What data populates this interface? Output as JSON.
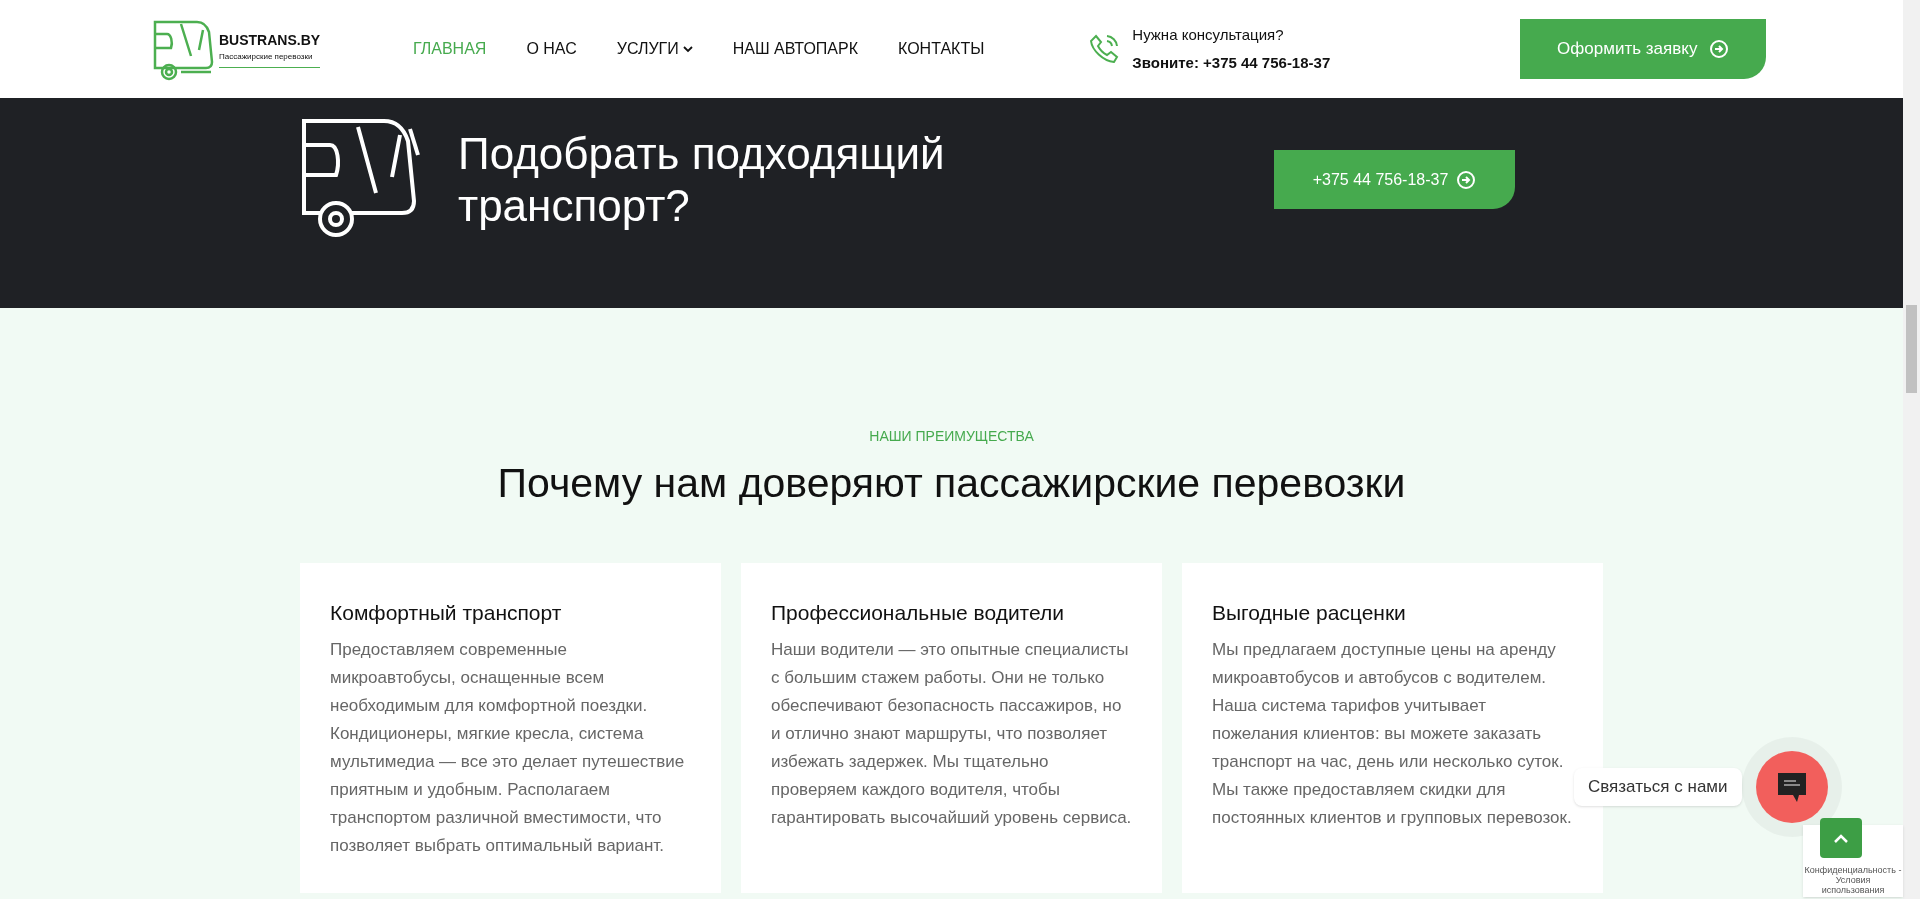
{
  "header": {
    "logo": {
      "name": "BUSTRANS.BY",
      "tagline": "Пассажирские перевозки"
    },
    "nav": [
      {
        "label": "ГЛАВНАЯ",
        "selected": true,
        "has_dropdown": false
      },
      {
        "label": "О НАС",
        "selected": false,
        "has_dropdown": false
      },
      {
        "label": "УСЛУГИ",
        "selected": false,
        "has_dropdown": true
      },
      {
        "label": "НАШ АВТОПАРК",
        "selected": false,
        "has_dropdown": false
      },
      {
        "label": "КОНТАКТЫ",
        "selected": false,
        "has_dropdown": false
      }
    ],
    "contact": {
      "question": "Нужна консультация?",
      "phone": "Звоните: +375 44 756-18-37"
    },
    "cta_button": "Оформить заявку"
  },
  "banner": {
    "title": "Подобрать подходящий транспорт?",
    "button": "+375 44 756-18-37"
  },
  "advantages": {
    "eyebrow": "НАШИ ПРЕИМУЩЕСТВА",
    "title": "Почему нам доверяют пассажирские перевозки",
    "cards": [
      {
        "title": "Комфортный транспорт",
        "text": "Предоставляем современные микроавтобусы, оснащенные всем необходимым для комфортной поездки. Кондиционеры, мягкие кресла, система мультимедиа — все это делает путешествие приятным и удобным. Располагаем транспортом различной вместимости, что позволяет выбрать оптимальный вариант."
      },
      {
        "title": "Профессиональные водители",
        "text": "Наши водители — это опытные специалисты с большим стажем работы. Они не только обеспечивают безопасность пассажиров, но и отлично знают маршруты, что позволяет избежать задержек. Мы тщательно проверяем каждого водителя, чтобы гарантировать высочайший уровень сервиса."
      },
      {
        "title": "Выгодные расценки",
        "text": "Мы предлагаем доступные цены на аренду микроавтобусов и автобусов с водителем. Наша система тарифов учитывает пожелания клиентов: вы можете заказать транспорт на час, день или несколько суток. Мы также предоставляем скидки для постоянных клиентов и групповых перевозок."
      }
    ]
  },
  "chat_widget": {
    "label": "Связаться с нами"
  },
  "recaptcha": {
    "text": "Конфиденциальность - Условия использования"
  }
}
